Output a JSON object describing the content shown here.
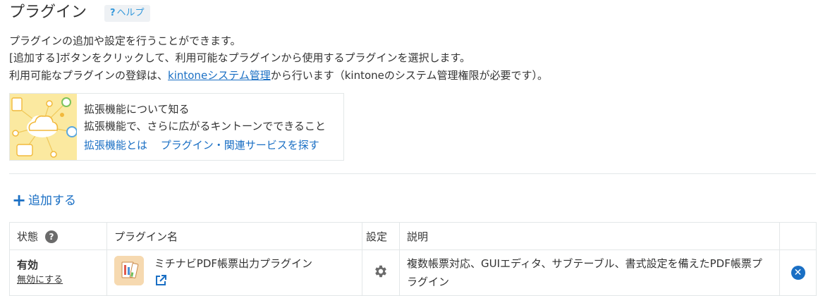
{
  "header": {
    "title": "プラグイン",
    "help_label": "ヘルプ",
    "help_mark": "?"
  },
  "description": {
    "line1": "プラグインの追加や設定を行うことができます。",
    "line2": "[追加する]ボタンをクリックして、利用可能なプラグインから使用するプラグインを選択します。",
    "line3_before": "利用可能なプラグインの登録は、",
    "line3_link": "kintoneシステム管理",
    "line3_after": "から行います（kintoneのシステム管理権限が必要です）。"
  },
  "extension_box": {
    "heading": "拡張機能について知る",
    "subtext": "拡張機能で、さらに広がるキントーンでできること",
    "link_about": "拡張機能とは",
    "link_search": "プラグイン・関連サービスを探す"
  },
  "add_button": {
    "label": "追加する",
    "icon": "plus-icon"
  },
  "table": {
    "headers": {
      "status": "状態",
      "name": "プラグイン名",
      "settings": "設定",
      "description": "説明"
    },
    "rows": [
      {
        "status": "有効",
        "toggle_link": "無効にする",
        "name": "ミチナビPDF帳票出力プラグイン",
        "description": "複数帳票対応、GUIエディタ、サブテーブル、書式設定を備えたPDF帳票プラグイン"
      }
    ]
  },
  "colors": {
    "link": "#1a6fc4",
    "help_badge_bg": "#eef1f4",
    "border": "#e3e7e8",
    "illustration_bg": "#fbe9a0"
  }
}
